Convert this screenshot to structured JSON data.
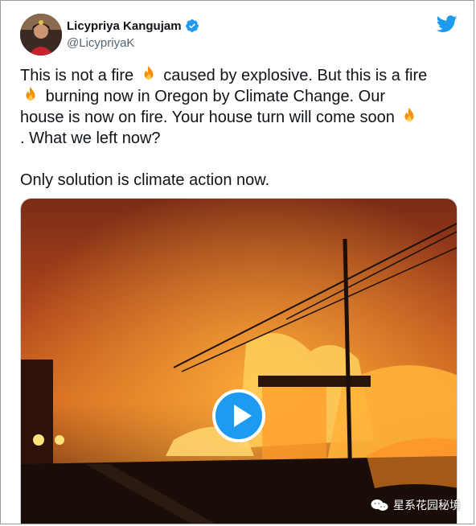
{
  "tweet": {
    "author": {
      "display_name": "Licypriya Kangujam",
      "handle": "@LicypriyaK",
      "verified": true,
      "avatar_icon": "avatar-photo"
    },
    "brand_icon": "twitter-bird-icon",
    "text_lines": {
      "p1_a": "This is not a fire",
      "p1_b": "caused by explosive. But this is a fire",
      "p1_c": "burning now in Oregon by Climate Change. Our",
      "p1_d": "house is now on fire. Your house turn will come soon",
      "p1_e": ". What we left now?",
      "p2": "Only solution is climate action now."
    },
    "emoji_icon": "fire-emoji-icon",
    "media": {
      "type": "video",
      "description_icon": "play-button-icon"
    }
  },
  "watermark": {
    "label": "星系花园秘境",
    "icon": "wechat-icon"
  },
  "colors": {
    "twitter_blue": "#1d9bf0",
    "text": "#0f1419",
    "handle": "#536471"
  }
}
